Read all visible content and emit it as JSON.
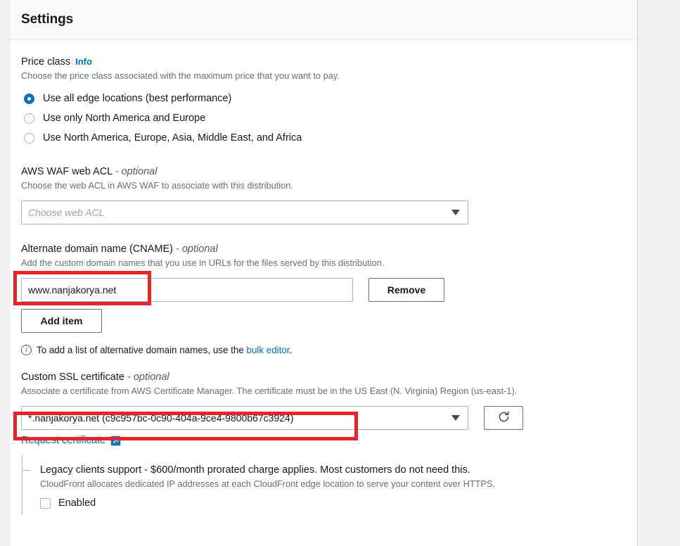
{
  "panel": {
    "title": "Settings"
  },
  "price_class": {
    "label": "Price class",
    "info_label": "Info",
    "description": "Choose the price class associated with the maximum price that you want to pay.",
    "options": [
      {
        "label": "Use all edge locations (best performance)",
        "selected": true
      },
      {
        "label": "Use only North America and Europe",
        "selected": false
      },
      {
        "label": "Use North America, Europe, Asia, Middle East, and Africa",
        "selected": false
      }
    ]
  },
  "waf": {
    "label": "AWS WAF web ACL",
    "optional": "- optional",
    "description": "Choose the web ACL in AWS WAF to associate with this distribution.",
    "placeholder": "Choose web ACL",
    "value": ""
  },
  "cname": {
    "label": "Alternate domain name (CNAME)",
    "optional": "- optional",
    "description": "Add the custom domain names that you use in URLs for the files served by this distribution.",
    "value": "www.nanjakorya.net",
    "remove_label": "Remove",
    "add_item_label": "Add item",
    "hint_prefix": "To add a list of alternative domain names, use the",
    "hint_link": "bulk editor",
    "hint_suffix": "."
  },
  "ssl": {
    "label": "Custom SSL certificate",
    "optional": "- optional",
    "description": "Associate a certificate from AWS Certificate Manager. The certificate must be in the US East (N. Virginia) Region (us-east-1).",
    "value": "*.nanjakorya.net (c9c957bc-0c90-404a-9ce4-9800b67c3924)",
    "refresh_label": "refresh-icon",
    "request_link": "Request certificate"
  },
  "legacy": {
    "title": "Legacy clients support - $600/month prorated charge applies. Most customers do not need this.",
    "description": "CloudFront allocates dedicated IP addresses at each CloudFront edge location to serve your content over HTTPS.",
    "enabled_label": "Enabled",
    "enabled_checked": false
  },
  "colors": {
    "accent": "#0073bb",
    "annotation": "#e8232a",
    "text": "#16191f",
    "muted": "#687078"
  }
}
